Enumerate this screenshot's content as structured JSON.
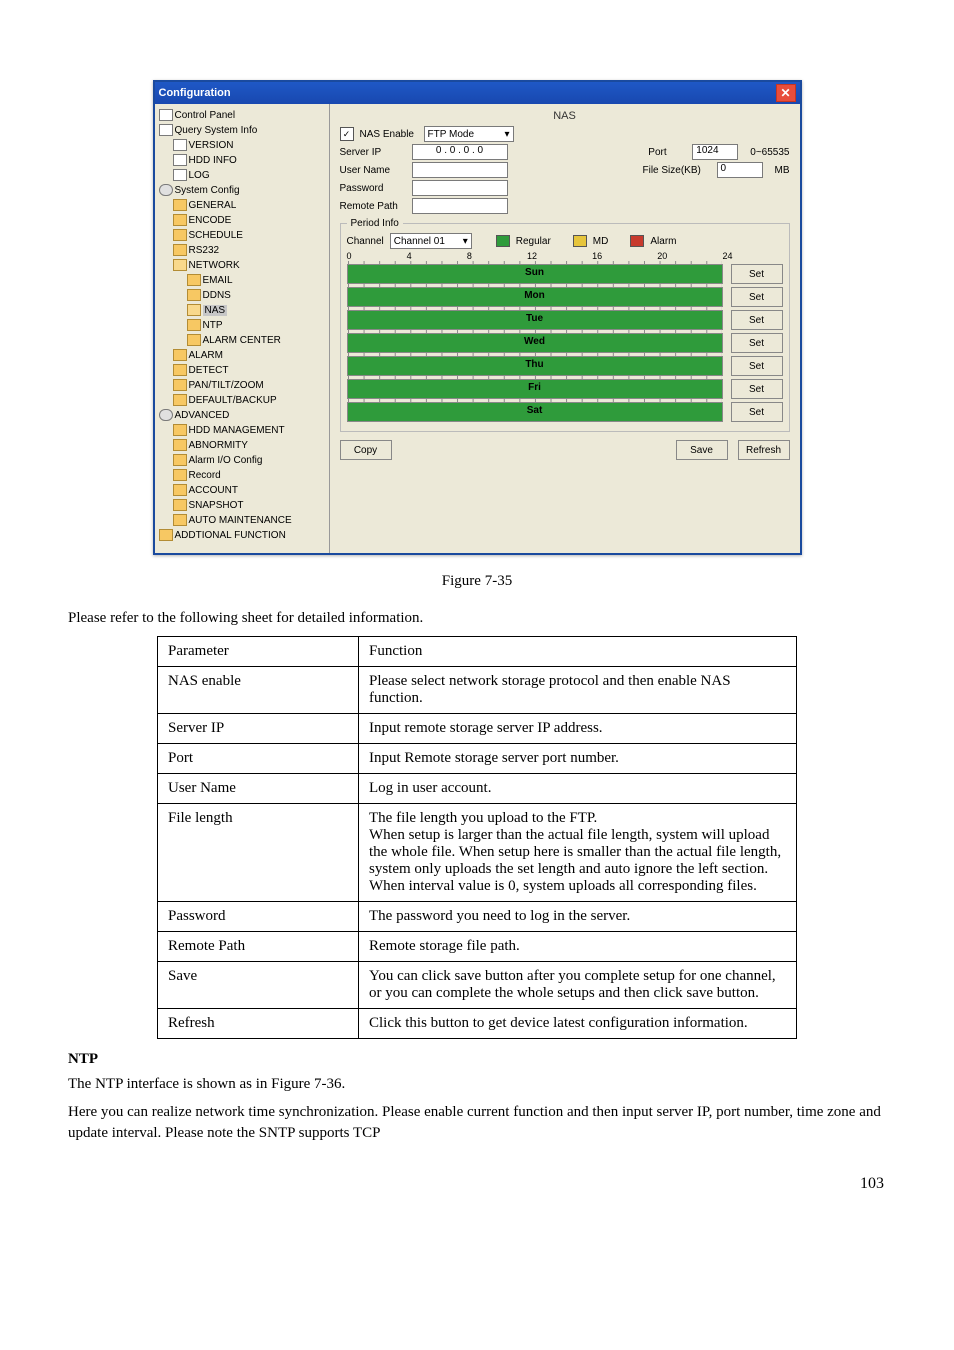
{
  "window": {
    "title": "Configuration"
  },
  "tree": {
    "control_panel": "Control Panel",
    "query": "Query System Info",
    "version": "VERSION",
    "hddinfo": "HDD INFO",
    "log": "LOG",
    "syscfg": "System Config",
    "general": "GENERAL",
    "encode": "ENCODE",
    "schedule": "SCHEDULE",
    "rs232": "RS232",
    "network": "NETWORK",
    "email": "EMAIL",
    "ddns": "DDNS",
    "nas": "NAS",
    "ntp": "NTP",
    "alarmcenter": "ALARM CENTER",
    "alarm": "ALARM",
    "detect": "DETECT",
    "pantilt": "PAN/TILT/ZOOM",
    "defback": "DEFAULT/BACKUP",
    "advanced": "ADVANCED",
    "hddmgmt": "HDD MANAGEMENT",
    "abnormity": "ABNORMITY",
    "alarmio": "Alarm I/O Config",
    "record": "Record",
    "account": "ACCOUNT",
    "snapshot": "SNAPSHOT",
    "automaint": "AUTO MAINTENANCE",
    "addfunc": "ADDTIONAL FUNCTION"
  },
  "nas": {
    "title": "NAS",
    "enable_label": "NAS Enable",
    "mode": "FTP Mode",
    "serverip_label": "Server IP",
    "serverip_value": "0 . 0 . 0 . 0",
    "port_label": "Port",
    "port_value": "1024",
    "port_range": "0~65535",
    "username_label": "User Name",
    "filesize_label": "File Size(KB)",
    "filesize_value": "0",
    "filesize_unit": "MB",
    "password_label": "Password",
    "remotepath_label": "Remote Path",
    "period_legend": "Period Info",
    "channel_label": "Channel",
    "channel_value": "Channel 01",
    "regular": "Regular",
    "md": "MD",
    "alarm": "Alarm",
    "ticks": [
      "0",
      "4",
      "8",
      "12",
      "16",
      "20",
      "24"
    ],
    "days": [
      "Sun",
      "Mon",
      "Tue",
      "Wed",
      "Thu",
      "Fri",
      "Sat"
    ],
    "set": "Set",
    "copy": "Copy",
    "save": "Save",
    "refresh": "Refresh"
  },
  "doc": {
    "caption": "Figure 7-35",
    "lead": "Please refer to the following sheet for detailed information.",
    "hdr_param": "Parameter",
    "hdr_func": "Function",
    "rows": [
      {
        "p": "NAS enable",
        "f": "Please select network storage protocol and then enable NAS function."
      },
      {
        "p": "Server IP",
        "f": "Input remote storage server IP address."
      },
      {
        "p": "Port",
        "f": "Input Remote storage server port number."
      },
      {
        "p": "User Name",
        "f": "Log in user account."
      },
      {
        "p": "File length",
        "f": "The file length you upload to the FTP.\nWhen setup is larger than the actual file length, system will upload the whole file. When setup here is smaller than the actual file length, system only uploads the set length and auto ignore the left section. When interval value is 0, system uploads all corresponding files."
      },
      {
        "p": "Password",
        "f": "The password you need to log in the server."
      },
      {
        "p": "Remote Path",
        "f": "Remote storage file path."
      },
      {
        "p": "Save",
        "f": "You can click save button after you complete setup for one channel, or you can complete the whole setups and then click save button."
      },
      {
        "p": "Refresh",
        "f": "Click this button to get device latest configuration information."
      }
    ],
    "ntp_head": "NTP",
    "ntp_p1": "The NTP interface is shown as in Figure 7-36.",
    "ntp_p2": "Here you can realize network time synchronization. Please enable current function and then input server IP, port number, time zone and update interval. Please note the SNTP supports TCP",
    "pagenum": "103"
  }
}
